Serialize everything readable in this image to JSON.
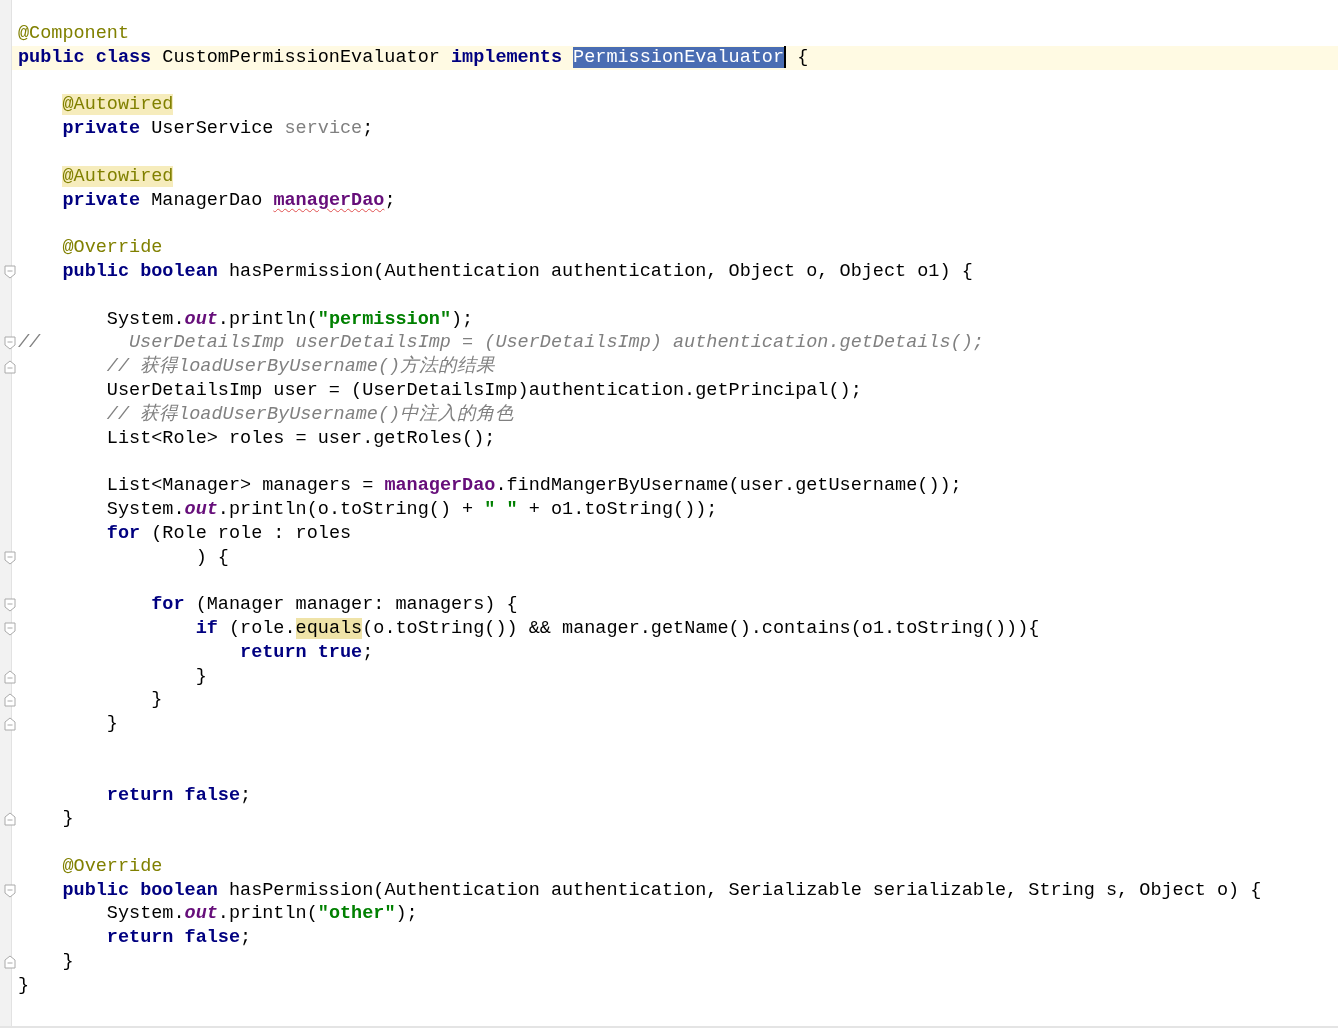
{
  "editor": {
    "lines": [
      {
        "tokens": [
          {
            "kind": "annotation",
            "text": "@Component"
          }
        ]
      },
      {
        "current": true,
        "tokens": [
          {
            "kind": "keyword",
            "text": "public class "
          },
          {
            "kind": "plain",
            "text": "CustomPermissionEvaluator "
          },
          {
            "kind": "keyword",
            "text": "implements "
          },
          {
            "kind": "selected",
            "text": "PermissionEvaluator",
            "caret": true
          },
          {
            "kind": "plain",
            "text": " {"
          }
        ]
      },
      {
        "blank_before": true,
        "tokens": [
          {
            "kind": "annotation_marked",
            "text": "    @Autowired"
          }
        ]
      },
      {
        "tokens": [
          {
            "kind": "keyword",
            "text": "    private "
          },
          {
            "kind": "plain",
            "text": "UserService "
          },
          {
            "kind": "unused",
            "text": "service"
          },
          {
            "kind": "plain",
            "text": ";"
          }
        ]
      },
      {
        "blank_before": true,
        "tokens": [
          {
            "kind": "annotation_marked",
            "text": "    @Autowired"
          }
        ]
      },
      {
        "tokens": [
          {
            "kind": "keyword",
            "text": "    private "
          },
          {
            "kind": "plain",
            "text": "ManagerDao "
          },
          {
            "kind": "field_warning",
            "text": "managerDao"
          },
          {
            "kind": "plain",
            "text": ";"
          }
        ]
      },
      {
        "blank_before": true,
        "tokens": [
          {
            "kind": "annotation",
            "text": "    @Override"
          }
        ]
      },
      {
        "fold_open": true,
        "tokens": [
          {
            "kind": "keyword",
            "text": "    public boolean "
          },
          {
            "kind": "plain",
            "text": "hasPermission(Authentication authentication, Object o, Object o1) {"
          }
        ]
      },
      {
        "blank_before": true,
        "tokens": [
          {
            "kind": "plain",
            "text": "        System."
          },
          {
            "kind": "static",
            "text": "out"
          },
          {
            "kind": "plain",
            "text": ".println("
          },
          {
            "kind": "string",
            "text": "\"permission\""
          },
          {
            "kind": "plain",
            "text": ");"
          }
        ]
      },
      {
        "fold_open": true,
        "tokens": [
          {
            "kind": "comment",
            "text": "//        UserDetailsImp userDetailsImp = (UserDetailsImp) authentication.getDetails();"
          }
        ]
      },
      {
        "fold_close": true,
        "tokens": [
          {
            "kind": "comment",
            "text": "        // 获得loadUserByUsername()方法的结果"
          }
        ]
      },
      {
        "tokens": [
          {
            "kind": "plain",
            "text": "        UserDetailsImp user = (UserDetailsImp)authentication.getPrincipal();"
          }
        ]
      },
      {
        "tokens": [
          {
            "kind": "comment",
            "text": "        // 获得loadUserByUsername()中注入的角色"
          }
        ]
      },
      {
        "tokens": [
          {
            "kind": "plain",
            "text": "        List<Role> roles = user.getRoles();"
          }
        ]
      },
      {
        "blank_before": true,
        "tokens": [
          {
            "kind": "plain",
            "text": "        List<Manager> managers = "
          },
          {
            "kind": "field",
            "text": "managerDao"
          },
          {
            "kind": "plain",
            "text": ".findMangerByUsername(user.getUsername());"
          }
        ]
      },
      {
        "tokens": [
          {
            "kind": "plain",
            "text": "        System."
          },
          {
            "kind": "static",
            "text": "out"
          },
          {
            "kind": "plain",
            "text": ".println(o.toString() + "
          },
          {
            "kind": "string",
            "text": "\" \""
          },
          {
            "kind": "plain",
            "text": " + o1.toString());"
          }
        ]
      },
      {
        "tokens": [
          {
            "kind": "keyword",
            "text": "        for "
          },
          {
            "kind": "plain",
            "text": "(Role role : roles"
          }
        ]
      },
      {
        "fold_open": true,
        "tokens": [
          {
            "kind": "plain",
            "text": "                ) {"
          }
        ]
      },
      {
        "blank_before": true,
        "fold_open": true,
        "tokens": [
          {
            "kind": "keyword",
            "text": "            for "
          },
          {
            "kind": "plain",
            "text": "(Manager manager: managers) {"
          }
        ]
      },
      {
        "fold_open": true,
        "tokens": [
          {
            "kind": "keyword",
            "text": "                if "
          },
          {
            "kind": "plain",
            "text": "(role."
          },
          {
            "kind": "match",
            "text": "equals"
          },
          {
            "kind": "plain",
            "text": "(o.toString()) && manager.getName().contains(o1.toString())){"
          }
        ]
      },
      {
        "tokens": [
          {
            "kind": "keyword",
            "text": "                    return true"
          },
          {
            "kind": "plain",
            "text": ";"
          }
        ]
      },
      {
        "fold_close": true,
        "tokens": [
          {
            "kind": "plain",
            "text": "                }"
          }
        ]
      },
      {
        "fold_close": true,
        "tokens": [
          {
            "kind": "plain",
            "text": "            }"
          }
        ]
      },
      {
        "fold_close": true,
        "blank_after": true,
        "tokens": [
          {
            "kind": "plain",
            "text": "        }"
          }
        ]
      },
      {
        "blank_before": true,
        "tokens": [
          {
            "kind": "keyword",
            "text": "        return false"
          },
          {
            "kind": "plain",
            "text": ";"
          }
        ]
      },
      {
        "fold_close": true,
        "tokens": [
          {
            "kind": "plain",
            "text": "    }"
          }
        ]
      },
      {
        "blank_before": true,
        "tokens": [
          {
            "kind": "annotation",
            "text": "    @Override"
          }
        ]
      },
      {
        "fold_open": true,
        "tokens": [
          {
            "kind": "keyword",
            "text": "    public boolean "
          },
          {
            "kind": "plain",
            "text": "hasPermission(Authentication authentication, Serializable serializable, String s, Object o) {"
          }
        ]
      },
      {
        "tokens": [
          {
            "kind": "plain",
            "text": "        System."
          },
          {
            "kind": "static",
            "text": "out"
          },
          {
            "kind": "plain",
            "text": ".println("
          },
          {
            "kind": "string",
            "text": "\"other\""
          },
          {
            "kind": "plain",
            "text": ");"
          }
        ]
      },
      {
        "tokens": [
          {
            "kind": "keyword",
            "text": "        return false"
          },
          {
            "kind": "plain",
            "text": ";"
          }
        ]
      },
      {
        "fold_close": true,
        "tokens": [
          {
            "kind": "plain",
            "text": "    }"
          }
        ]
      },
      {
        "tokens": [
          {
            "kind": "plain",
            "text": "}"
          }
        ]
      }
    ]
  }
}
